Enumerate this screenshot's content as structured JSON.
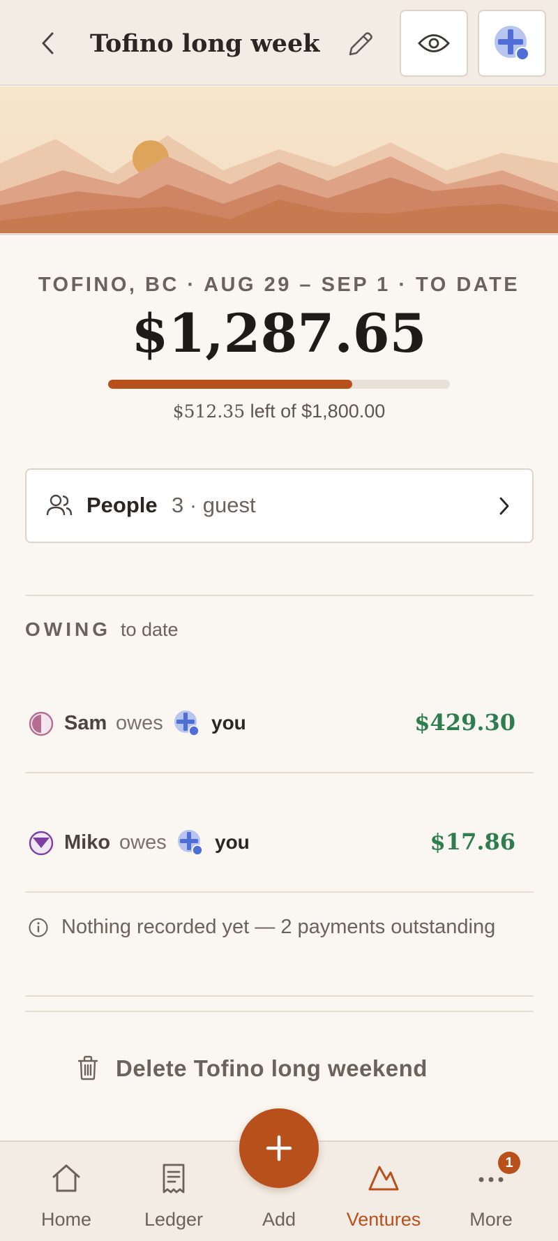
{
  "header": {
    "title": "Tofino long week…",
    "back_icon": "chevron-left-icon",
    "edit_icon": "pencil-icon",
    "eye_icon": "eye-icon"
  },
  "summary": {
    "meta": "TOFINO, BC · AUG 29 – SEP 1 · TO DATE",
    "total": "$1,287.65",
    "budget_spent_fraction": 0.715,
    "remaining_amount": "$512.35",
    "remaining_text": " left of $1,800.00"
  },
  "people": {
    "label": "People",
    "sub": "3 · guest"
  },
  "owing": {
    "heading": "OWING",
    "sub": "to date",
    "rows": [
      {
        "name": "Sam",
        "verb": "owes",
        "target": "you",
        "amount": "$429.30"
      },
      {
        "name": "Miko",
        "verb": "owes",
        "target": "you",
        "amount": "$17.86"
      }
    ],
    "note": "Nothing recorded yet — 2 payments outstanding"
  },
  "delete_label": "Delete Tofino long weekend",
  "nav": {
    "items": [
      {
        "label": "Home",
        "icon": "home-icon"
      },
      {
        "label": "Ledger",
        "icon": "receipt-icon"
      },
      {
        "label": "Add",
        "icon": "plus-icon"
      },
      {
        "label": "Ventures",
        "icon": "mountain-icon"
      },
      {
        "label": "More",
        "icon": "more-icon"
      }
    ],
    "active": "Ventures",
    "more_badge": "1"
  },
  "colors": {
    "accent": "#b8501c",
    "positive": "#2e7d4f",
    "background": "#faf6f1"
  }
}
